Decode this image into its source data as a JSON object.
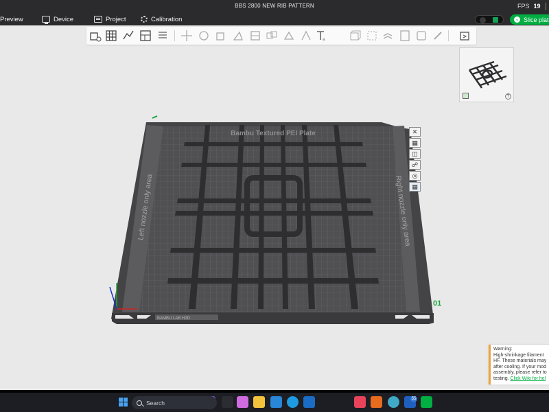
{
  "window": {
    "title": "BBS 2800 NEW RIB PATTERN",
    "fps_label": "FPS",
    "fps_value": "19"
  },
  "menu": {
    "preview": "Preview",
    "device": "Device",
    "project": "Project",
    "calibration": "Calibration",
    "slice_button": "Slice plate"
  },
  "toolbar": {
    "icons": [
      "add-object-icon",
      "arrange-grid-icon",
      "auto-orient-icon",
      "plate-layout-icon",
      "layers-list-icon",
      "move-icon",
      "rotate-icon",
      "scale-icon",
      "lay-on-face-icon",
      "cut-icon",
      "split-parts-icon",
      "support-paint-icon",
      "seam-paint-icon",
      "text-icon",
      "mesh-boolean-icon",
      "measure-icon",
      "assembly-icon",
      "variable-layer-icon",
      "color-paint-icon",
      "brim-ears-icon",
      "emboss-icon"
    ]
  },
  "plate": {
    "label": "Bambu Textured PEI Plate",
    "left_area": "Left nozzle only area",
    "right_area": "Right nozzle only area",
    "plate_number": "01",
    "brand_label": "BAMBU LAB H2D",
    "side_icons": [
      "close-plate-icon",
      "arrange-plate-icon",
      "orient-plate-icon",
      "lock-plate-icon",
      "plate-settings-icon",
      "plate-filament-icon"
    ]
  },
  "warning": {
    "lines": [
      "Warning:",
      "High-shrinkage filament",
      "HF. These materials may",
      "after cooling. If your mod",
      "assembly, please refer to",
      "testing. Click Wiki for hel"
    ]
  },
  "taskbar": {
    "search_placeholder": "Search",
    "badge_count": "55"
  },
  "colors": {
    "accent": "#00ae42",
    "plate": "#4a4a4c",
    "rib": "#2f2f31",
    "warning_accent": "#f0a23a"
  }
}
